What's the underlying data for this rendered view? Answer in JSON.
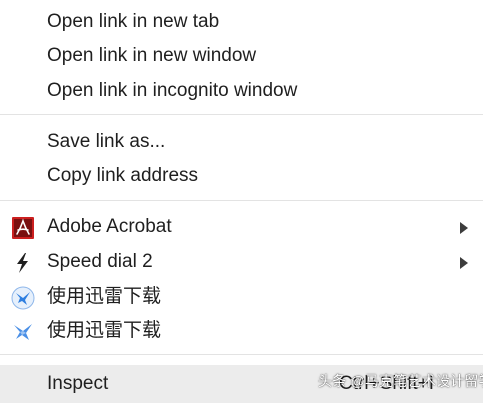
{
  "menu": {
    "group1": [
      {
        "label": "Open link in new tab"
      },
      {
        "label": "Open link in new window"
      },
      {
        "label": "Open link in incognito window"
      }
    ],
    "group2": [
      {
        "label": "Save link as..."
      },
      {
        "label": "Copy link address"
      }
    ],
    "group3": [
      {
        "label": "Adobe Acrobat",
        "icon": "adobe-acrobat-icon",
        "has_submenu": true
      },
      {
        "label": "Speed dial 2",
        "icon": "lightning-bolt-icon",
        "has_submenu": true
      },
      {
        "label": "使用迅雷下载",
        "icon": "thunder-bird-icon-round"
      },
      {
        "label": "使用迅雷下载",
        "icon": "thunder-bird-icon"
      }
    ],
    "inspect": {
      "label": "Inspect",
      "shortcut": "Ctrl+Shift+I"
    }
  },
  "watermark": "头条 @马克笔艺术设计留学",
  "colors": {
    "acrobat_red": "#cc1f1f",
    "thunder_blue": "#2f7fe0",
    "hover_bg": "#ececec",
    "separator": "#e3e3e3"
  }
}
